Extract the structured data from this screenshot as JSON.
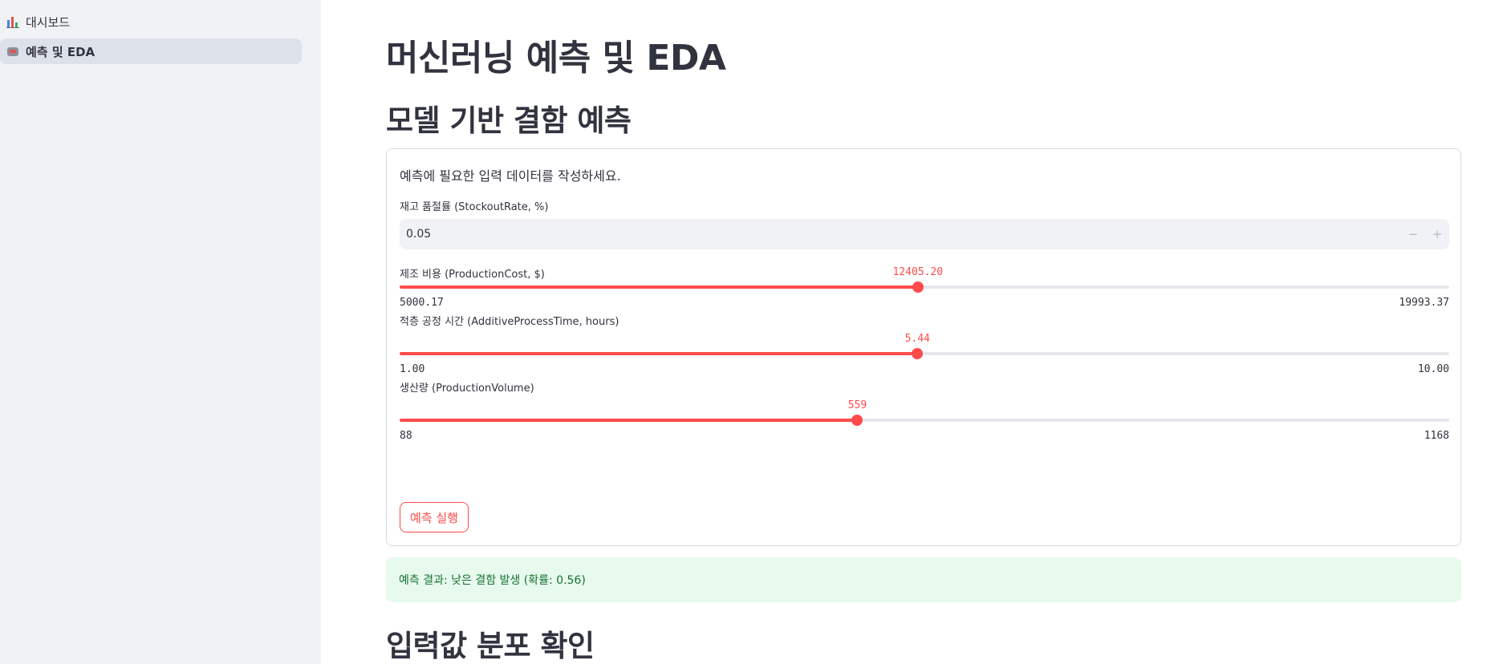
{
  "sidebar": {
    "items": [
      {
        "label": "대시보드",
        "icon": "bar-chart-icon",
        "active": false
      },
      {
        "label": "예측 및 EDA",
        "icon": "robot-icon",
        "active": true
      }
    ]
  },
  "main": {
    "title": "머신러닝 예측 및 EDA",
    "section1_title": "모델 기반 결함 예측",
    "form": {
      "instruction": "예측에 필요한 입력 데이터를 작성하세요.",
      "stockout": {
        "label": "재고 품절률 (StockoutRate, %)",
        "value": "0.05",
        "minus": "−",
        "plus": "+"
      },
      "sliders": [
        {
          "label": "제조 비용 (ProductionCost, $)",
          "value": "12405.20",
          "min": "5000.17",
          "max": "19993.37",
          "fraction": 0.4937
        },
        {
          "label": "적층 공정 시간 (AdditiveProcessTime, hours)",
          "value": "5.44",
          "min": "1.00",
          "max": "10.00",
          "fraction": 0.4933
        },
        {
          "label": "생산량 (ProductionVolume)",
          "value": "559",
          "min": "88",
          "max": "1168",
          "fraction": 0.4361
        }
      ],
      "run_button": "예측 실행"
    },
    "result": "예측 결과: 낮은 결함 발생 (확률: 0.56)",
    "section2_title": "입력값 분포 확인"
  },
  "colors": {
    "accent": "#ff4b4b",
    "sidebar_bg": "#f0f2f6",
    "success_bg": "#e8f9ee",
    "success_text": "#177233"
  }
}
